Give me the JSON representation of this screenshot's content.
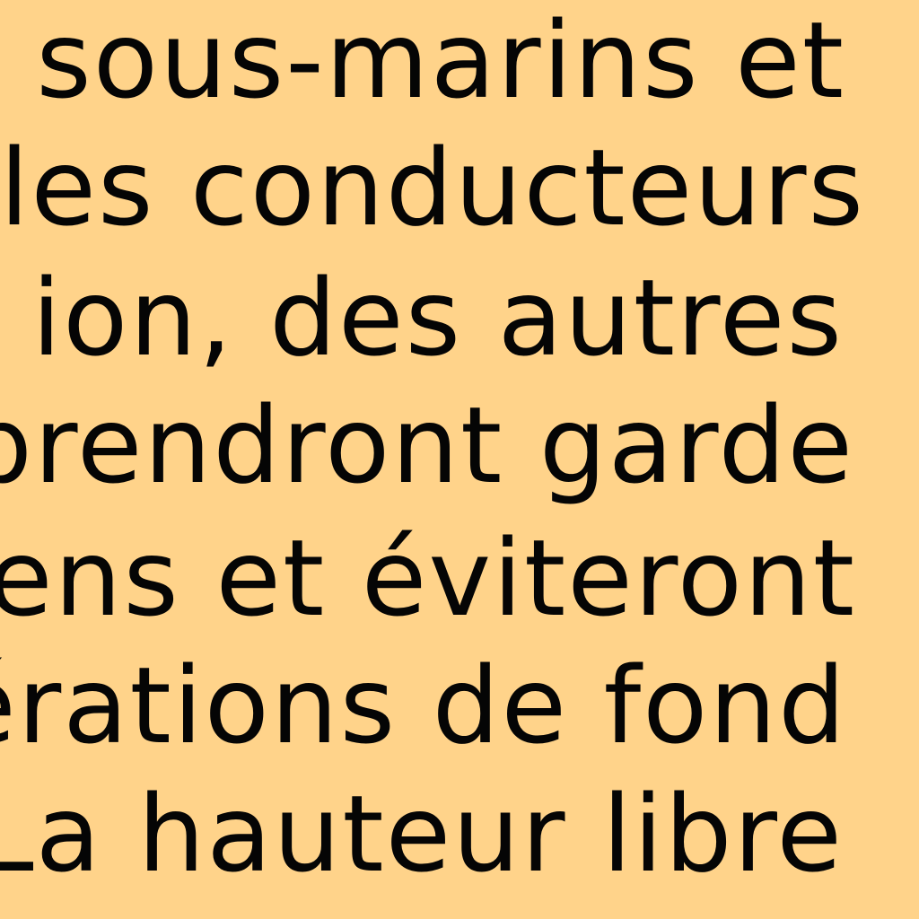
{
  "document": {
    "lines": [
      "s sous-marins et",
      "les conducteurs",
      "ion, des autres",
      "prendront garde",
      "ens et éviteront",
      "érations de fond",
      "La hauteur libre"
    ],
    "background_color": "#ffd38a",
    "text_color": "#050505"
  }
}
